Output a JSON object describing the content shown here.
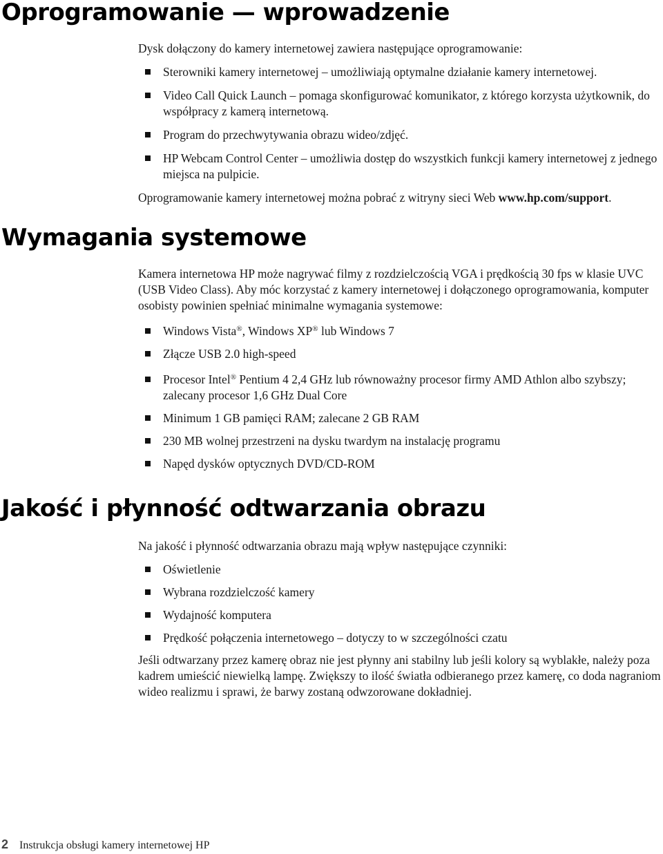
{
  "sections": [
    {
      "heading": "Oprogramowanie — wprowadzenie",
      "intro": "Dysk dołączony do kamery internetowej zawiera następujące oprogramowanie:",
      "bullets": [
        "Sterowniki kamery internetowej – umożliwiają optymalne działanie kamery internetowej.",
        "Video Call Quick Launch – pomaga skonfigurować komunikator, z którego korzysta użytkownik, do współpracy z kamerą internetową.",
        "Program do przechwytywania obrazu wideo/zdjęć.",
        "HP Webcam Control Center – umożliwia dostęp do wszystkich funkcji kamery internetowej z jednego miejsca na pulpicie."
      ],
      "outro_prefix": "Oprogramowanie kamery internetowej można pobrać z witryny sieci Web ",
      "outro_link": "www.hp.com/support",
      "outro_suffix": "."
    },
    {
      "heading": "Wymagania systemowe",
      "intro": "Kamera internetowa HP może nagrywać filmy z rozdzielczością VGA i prędkością 30 fps w klasie UVC (USB Video Class). Aby móc korzystać z kamery internetowej i dołączonego oprogramowania, komputer osobisty powinien spełniać minimalne wymagania systemowe:",
      "reg_mark": "®",
      "os_parts": [
        "Windows Vista",
        ", Windows XP",
        " lub Windows 7"
      ],
      "bullets": [
        "Złącze USB 2.0 high-speed",
        "Minimum 1 GB pamięci RAM; zalecane 2 GB RAM",
        "230 MB wolnej przestrzeni na dysku twardym na instalację programu",
        "Napęd dysków optycznych DVD/CD-ROM"
      ],
      "cpu_parts": [
        "Procesor Intel",
        " Pentium 4 2,4 GHz lub równoważny procesor firmy AMD Athlon albo szybszy; zalecany procesor 1,6 GHz Dual Core"
      ]
    },
    {
      "heading": "Jakość i  płynność odtwarzania obrazu",
      "intro": "Na jakość i płynność odtwarzania obrazu mają wpływ następujące czynniki:",
      "bullets": [
        "Oświetlenie",
        "Wybrana rozdzielczość kamery",
        "Wydajność komputera",
        "Prędkość połączenia internetowego – dotyczy to w szczególności czatu"
      ],
      "outro": "Jeśli odtwarzany przez kamerę obraz nie jest płynny ani stabilny lub jeśli kolory są wyblakłe, należy poza kadrem umieścić niewielką lampę. Zwiększy to ilość światła odbieranego przez kamerę, co doda nagraniom wideo realizmu i sprawi, że barwy zostaną odwzorowane dokładniej."
    }
  ],
  "footer": {
    "page_number": "2",
    "title": "Instrukcja obsługi kamery internetowej HP"
  }
}
